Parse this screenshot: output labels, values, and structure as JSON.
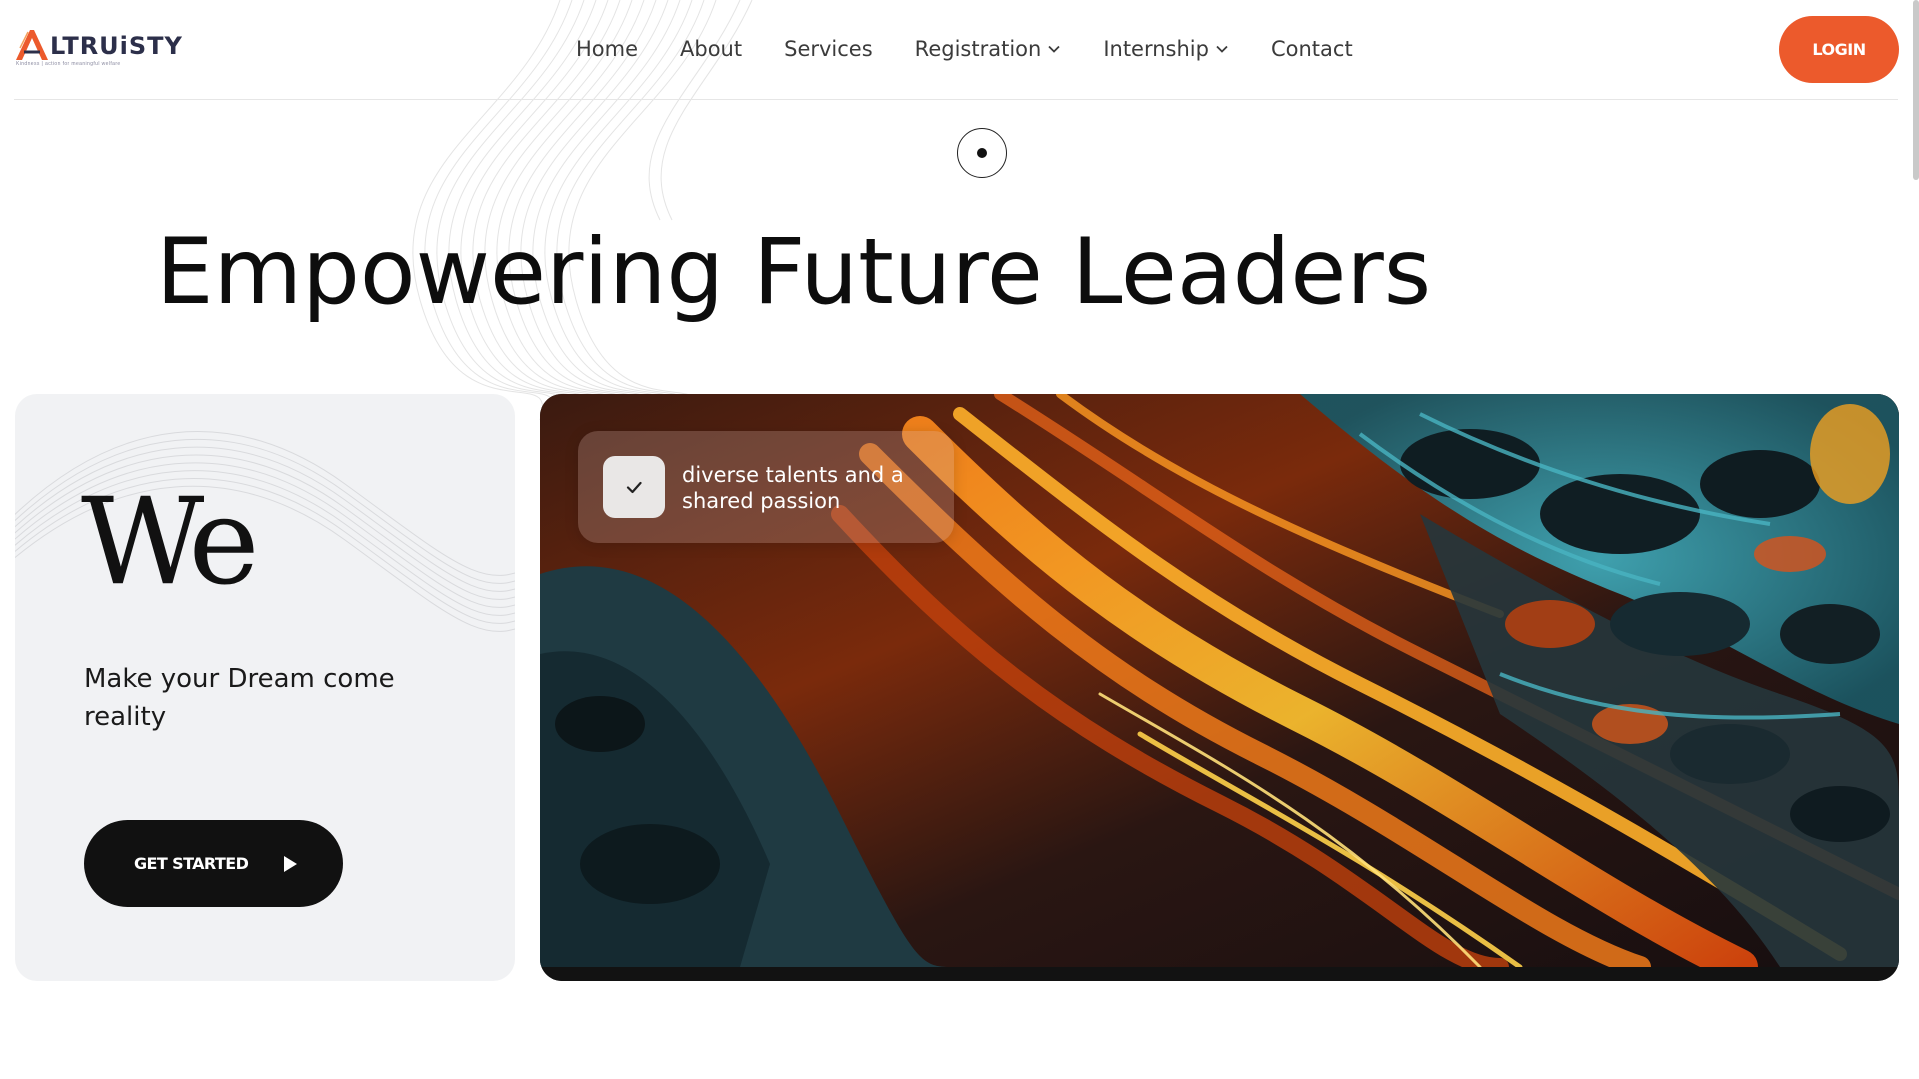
{
  "brand": {
    "logo_text": "LTRUiSTY",
    "logo_letter": "A",
    "tagline": "Kindness | action for meaningful welfare",
    "accent_color": "#ec5a2c",
    "icon": "altruisty-logo-icon"
  },
  "nav": {
    "items": [
      {
        "label": "Home",
        "has_dropdown": false
      },
      {
        "label": "About",
        "has_dropdown": false
      },
      {
        "label": "Services",
        "has_dropdown": false
      },
      {
        "label": "Registration",
        "has_dropdown": true,
        "icon": "chevron-down-icon"
      },
      {
        "label": "Internship",
        "has_dropdown": true,
        "icon": "chevron-down-icon"
      },
      {
        "label": "Contact",
        "has_dropdown": false
      }
    ],
    "login_label": "LOGIN"
  },
  "hero": {
    "title": "Empowering Future Leaders",
    "scroll_icon": "scroll-indicator-icon"
  },
  "left_card": {
    "heading": "We",
    "tagline": "Make your Dream come reality",
    "cta_label": "GET STARTED",
    "cta_icon": "play-icon",
    "background_color": "#f1f2f4"
  },
  "feature_card": {
    "badge_text": "diverse talents and a shared passion",
    "badge_icon": "check-icon",
    "image": "abstract-flowing-orange-teal-artwork"
  }
}
